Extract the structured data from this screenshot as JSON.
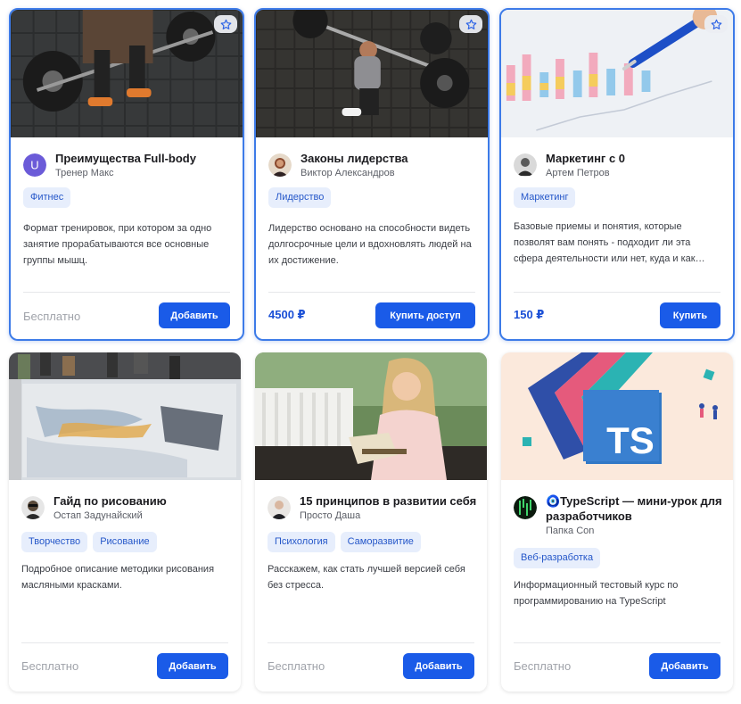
{
  "colors": {
    "accent": "#1a5be8",
    "price": "#1a4fd6",
    "tag_bg": "#e7eefc",
    "tag_text": "#2557c9",
    "selected_border": "#3d7be8"
  },
  "cards": [
    {
      "title": "Преимущества Full-body",
      "author": "Тренер Макс",
      "avatar_letter": "U",
      "tags": [
        "Фитнес"
      ],
      "description": "Формат тренировок, при котором за одно занятие прорабатываются все основные группы мышц.",
      "price": "Бесплатно",
      "button": "Добавить",
      "favorite_icon": "star-icon"
    },
    {
      "title": "Законы лидерства",
      "author": "Виктор Александров",
      "tags": [
        "Лидерство"
      ],
      "description": "Лидерство основано на способности видеть долгосрочные цели и вдохновлять людей на их достижение.",
      "price": "4500 ₽",
      "button": "Купить доступ",
      "favorite_icon": "star-icon"
    },
    {
      "title": "Маркетинг с 0",
      "author": "Артем Петров",
      "tags": [
        "Маркетинг"
      ],
      "description": "Базовые приемы и понятия, которые позволят вам понять - подходит ли эта сфера деятельности или нет, куда и как…",
      "price": "150 ₽",
      "button": "Купить",
      "favorite_icon": "star-icon"
    },
    {
      "title": "Гайд по рисованию",
      "author": "Остап Задунайский",
      "tags": [
        "Творчество",
        "Рисование"
      ],
      "description": "Подробное описание методики рисования масляными красками.",
      "price": "Бесплатно",
      "button": "Добавить"
    },
    {
      "title": "15 принципов в развитии себя",
      "author": "Просто Даша",
      "tags": [
        "Психология",
        "Саморазвитие"
      ],
      "description": "Расскажем, как стать лучшей версией себя без стресса.",
      "price": "Бесплатно",
      "button": "Добавить"
    },
    {
      "title": "🧿TypeScript — мини-урок для разработчиков",
      "author": "Папка Con",
      "tags": [
        "Веб-разработка"
      ],
      "description": "Информационный тестовый курс по программированию на TypeScript",
      "price": "Бесплатно",
      "button": "Добавить",
      "thumb_text": "TS"
    }
  ]
}
